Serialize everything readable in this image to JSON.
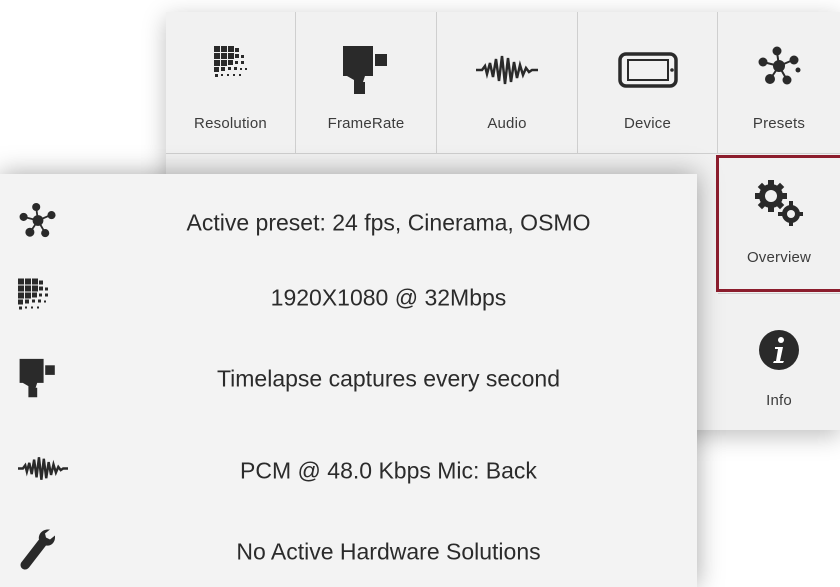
{
  "grid": {
    "items": [
      {
        "label": "Resolution",
        "icon": "resolution-icon"
      },
      {
        "label": "FrameRate",
        "icon": "camera-icon"
      },
      {
        "label": "Audio",
        "icon": "audio-wave-icon"
      },
      {
        "label": "Device",
        "icon": "device-icon"
      },
      {
        "label": "Presets",
        "icon": "presets-icon"
      },
      {
        "label": "Overview",
        "icon": "gears-icon"
      },
      {
        "label": "Info",
        "icon": "info-icon"
      }
    ],
    "highlight_color": "#8c1d2d"
  },
  "overview": {
    "rows": [
      {
        "icon": "presets-icon",
        "text": "Active preset: 24 fps, Cinerama, OSMO"
      },
      {
        "icon": "resolution-icon",
        "text": "1920X1080 @ 32Mbps"
      },
      {
        "icon": "camera-icon",
        "text": "Timelapse captures every second"
      },
      {
        "icon": "audio-wave-icon",
        "text": "PCM @ 48.0 Kbps Mic: Back"
      },
      {
        "icon": "wrench-icon",
        "text": "No Active Hardware Solutions"
      }
    ]
  }
}
